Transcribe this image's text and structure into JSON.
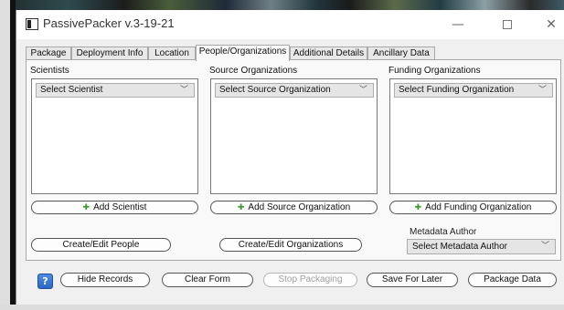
{
  "window": {
    "title": "PassivePacker v.3-19-21",
    "minimize_glyph": "—",
    "close_glyph": "✕"
  },
  "tabs": [
    {
      "label": "Package",
      "active": false
    },
    {
      "label": "Deployment Info",
      "active": false
    },
    {
      "label": "Location",
      "active": false
    },
    {
      "label": "People/Organizations",
      "active": true
    },
    {
      "label": "Additional Details",
      "active": false
    },
    {
      "label": "Ancillary Data",
      "active": false
    }
  ],
  "scientists": {
    "label": "Scientists",
    "select_value": "Select Scientist",
    "add_label": "Add Scientist",
    "edit_label": "Create/Edit People"
  },
  "source_orgs": {
    "label": "Source Organizations",
    "select_value": "Select Source Organization",
    "add_label": "Add Source Organization",
    "edit_label": "Create/Edit Organizations"
  },
  "funding_orgs": {
    "label": "Funding Organizations",
    "select_value": "Select Funding Organization",
    "add_label": "Add Funding Organization"
  },
  "metadata_author": {
    "label": "Metadata Author",
    "select_value": "Select Metadata Author"
  },
  "footer": {
    "help_glyph": "?",
    "hide_records": "Hide Records",
    "clear_form": "Clear Form",
    "stop_packaging": "Stop Packaging",
    "save_for_later": "Save For Later",
    "package_data": "Package Data"
  },
  "icons": {
    "plus": "✚",
    "chevron": "﹀"
  },
  "colors": {
    "plus_icon": "#3a9a2a",
    "help_button": "#2d66c4",
    "disabled_text": "#a0a0a0"
  }
}
